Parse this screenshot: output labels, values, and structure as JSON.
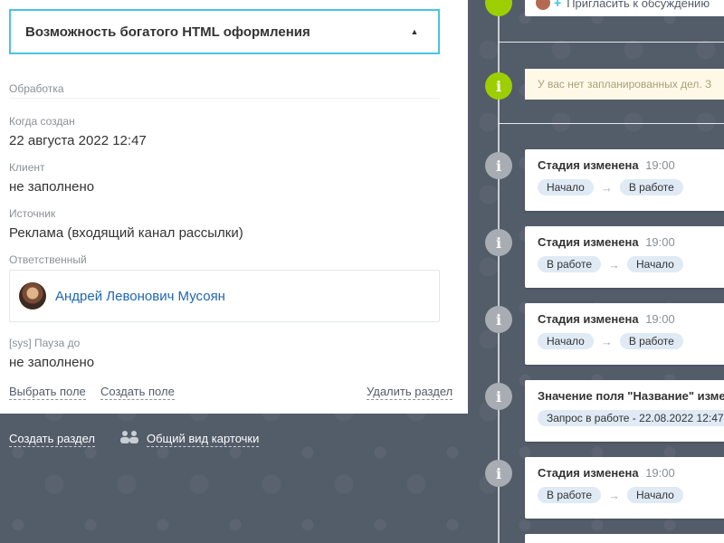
{
  "section": {
    "title": "Возможность богатого HTML оформления",
    "subsection": "Обработка"
  },
  "fields": [
    {
      "label": "Когда создан",
      "value": "22 августа 2022 12:47"
    },
    {
      "label": "Клиент",
      "value": "не заполнено"
    },
    {
      "label": "Источник",
      "value": "Реклама (входящий канал рассылки)"
    },
    {
      "label": "Ответственный",
      "value": "Андрей Левонович Мусоян"
    },
    {
      "label": "[sys] Пауза до",
      "value": "не заполнено"
    }
  ],
  "actions": {
    "select_field": "Выбрать поле",
    "create_field": "Создать поле",
    "delete_section": "Удалить раздел",
    "create_section": "Создать раздел",
    "common_view": "Общий вид карточки"
  },
  "timeline": {
    "invite": "Пригласить к обсуждению",
    "no_plans": "У вас нет запланированных дел. З",
    "events": [
      {
        "title": "Стадия изменена",
        "time": "19:00",
        "from": "Начало",
        "to": "В работе"
      },
      {
        "title": "Стадия изменена",
        "time": "19:00",
        "from": "В работе",
        "to": "Начало"
      },
      {
        "title": "Стадия изменена",
        "time": "19:00",
        "from": "Начало",
        "to": "В работе"
      },
      {
        "title": "Значение поля \"Название\" изме",
        "time": "",
        "value": "Запрос в работе - 22.08.2022 12:47"
      },
      {
        "title": "Стадия изменена",
        "time": "19:00",
        "from": "В работе",
        "to": "Начало"
      }
    ],
    "arrow": "→"
  },
  "icons": {
    "collapse": "caret-up-icon",
    "info": "info-icon",
    "chat": "chat-icon",
    "plus": "plus-icon",
    "people": "people-icon"
  },
  "colors": {
    "accent_border": "#49c3e6",
    "link": "#2066b0",
    "green": "#9dcf00",
    "pill": "#dfeaf5",
    "background": "#535c69"
  }
}
